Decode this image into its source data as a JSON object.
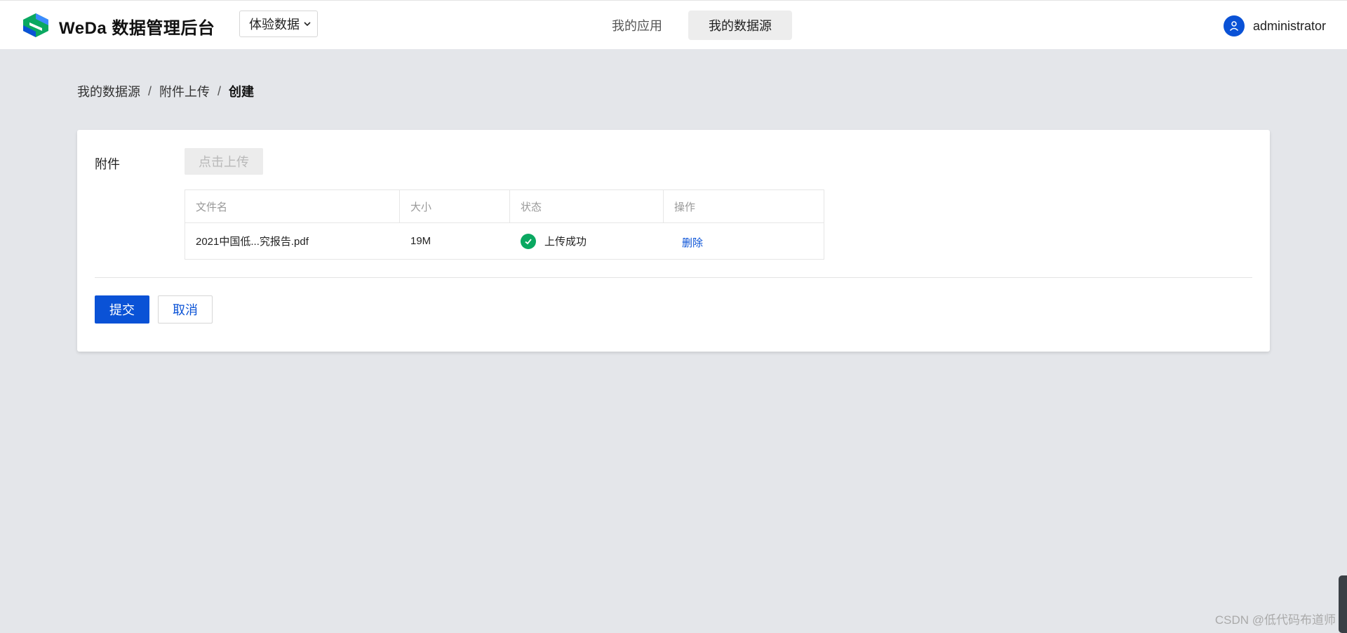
{
  "header": {
    "brand": "WeDa 数据管理后台",
    "env_select": "体验数据",
    "nav": [
      "我的应用",
      "我的数据源"
    ],
    "active_nav": "我的数据源",
    "user": "administrator"
  },
  "breadcrumb": {
    "items": [
      "我的数据源",
      "附件上传"
    ],
    "current": "创建"
  },
  "form": {
    "attachment_label": "附件",
    "upload_button": "点击上传",
    "table": {
      "columns": [
        "文件名",
        "大小",
        "状态",
        "操作"
      ],
      "rows": [
        {
          "name": "2021中国低...究报告.pdf",
          "size": "19M",
          "status": "上传成功",
          "action": "删除"
        }
      ]
    },
    "submit": "提交",
    "cancel": "取消"
  },
  "watermark": "CSDN @低代码布道师",
  "colors": {
    "primary": "#0a52d6",
    "success": "#0aa861",
    "page_bg": "#e4e6ea"
  }
}
